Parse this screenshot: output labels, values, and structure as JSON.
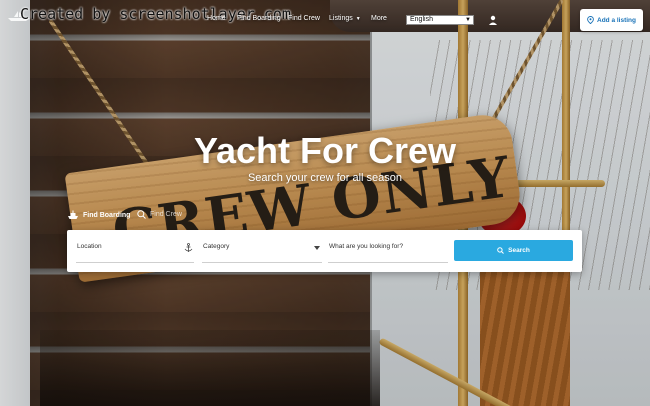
{
  "watermark": "Created by screenshotlayer.com",
  "nav": {
    "items": [
      {
        "label": "Home"
      },
      {
        "label": "Find Boarding"
      },
      {
        "label": "Find Crew"
      },
      {
        "label": "Listings"
      },
      {
        "label": "More"
      }
    ],
    "language": "English",
    "add_listing": "Add a listing"
  },
  "hero": {
    "sign_text": "CREW ONLY",
    "headline": "Yacht For Crew",
    "subline": "Search your crew for all season"
  },
  "tabs": [
    {
      "label": "Find Boarding",
      "active": true
    },
    {
      "label": "Find Crew",
      "active": false
    }
  ],
  "search": {
    "location_placeholder": "Location",
    "category_placeholder": "Category",
    "keyword_placeholder": "What are you looking for?",
    "button_label": "Search"
  },
  "colors": {
    "accent": "#2aa9e0",
    "link": "#1a73b8"
  }
}
